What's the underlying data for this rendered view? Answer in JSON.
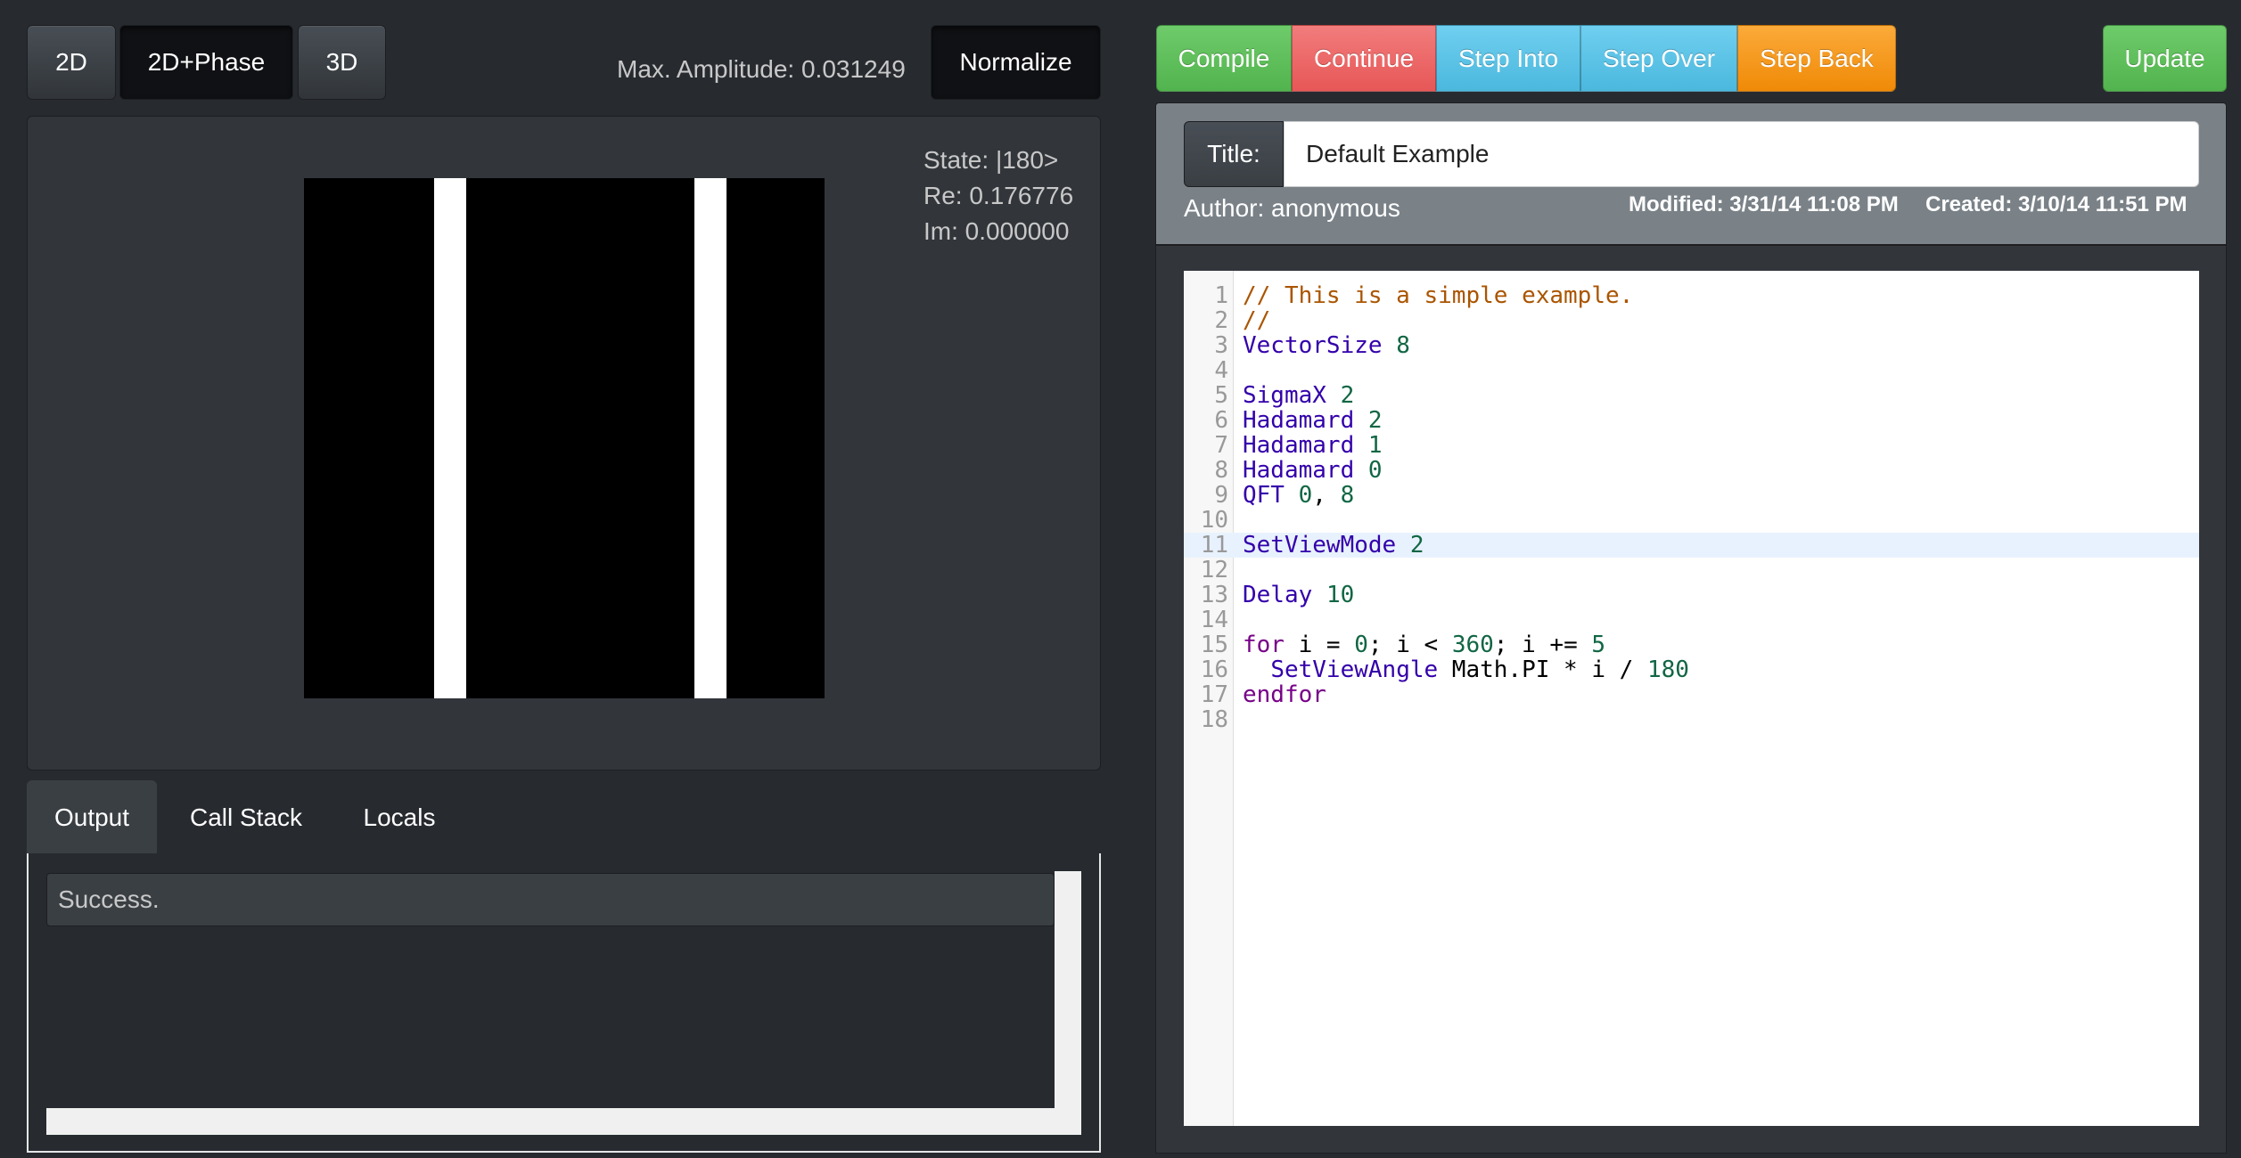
{
  "view_modes": [
    "2D",
    "2D+Phase",
    "3D"
  ],
  "active_view_mode": "2D+Phase",
  "max_amplitude_label": "Max. Amplitude: 0.031249",
  "normalize_label": "Normalize",
  "state_info": {
    "state": "State: |180>",
    "re": "Re: 0.176776",
    "im": "Im: 0.000000"
  },
  "tabs": [
    "Output",
    "Call Stack",
    "Locals"
  ],
  "active_tab": "Output",
  "output_text": "Success.",
  "debug_buttons": [
    "Compile",
    "Continue",
    "Step Into",
    "Step Over",
    "Step Back"
  ],
  "update_label": "Update",
  "title_label": "Title:",
  "title_value": "Default Example",
  "author": "Author: anonymous",
  "modified": "Modified: 3/31/14 11:08 PM",
  "created": "Created: 3/10/14 11:51 PM",
  "code_lines": [
    "// This is a simple example.",
    "//",
    "VectorSize 8",
    "",
    "SigmaX 2",
    "Hadamard 2",
    "Hadamard 1",
    "Hadamard 0",
    "QFT 0, 8",
    "",
    "SetViewMode 2",
    "",
    "Delay 10",
    "",
    "for i = 0; i < 360; i += 5",
    "  SetViewAngle Math.PI * i / 180",
    "endfor",
    ""
  ],
  "highlighted_line": 11,
  "colors": {
    "background": "#272b30",
    "compile": "#52b44e",
    "continue": "#e75757",
    "step": "#4bb8dd",
    "step_back": "#f08a07",
    "highlight_line": "#e8f2ff"
  }
}
